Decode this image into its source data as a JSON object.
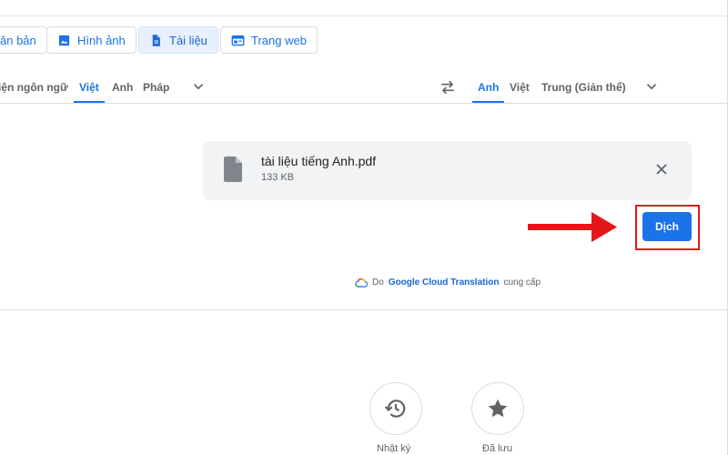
{
  "modes": [
    {
      "label": "ăn bản",
      "icon": "translate-text-icon"
    },
    {
      "label": "Hình ảnh",
      "icon": "image-icon"
    },
    {
      "label": "Tài liệu",
      "icon": "document-icon"
    },
    {
      "label": "Trang web",
      "icon": "website-icon"
    }
  ],
  "source_langs": [
    "iện ngôn ngữ",
    "Việt",
    "Anh",
    "Pháp"
  ],
  "target_langs": [
    "Anh",
    "Việt",
    "Trung (Giản thể)"
  ],
  "file": {
    "name": "tài liệu tiếng Anh.pdf",
    "size": "133 KB"
  },
  "translate_button": "Dịch",
  "attribution": {
    "prefix": "Do",
    "brand": "Google Cloud Translation",
    "suffix": "cung cấp"
  },
  "actions": [
    {
      "label": "Nhật ký",
      "icon": "history-icon"
    },
    {
      "label": "Đã lưu",
      "icon": "star-icon"
    }
  ],
  "colors": {
    "accent": "#1a73e8",
    "highlight": "#e3171a",
    "card": "#f1f3f4"
  }
}
